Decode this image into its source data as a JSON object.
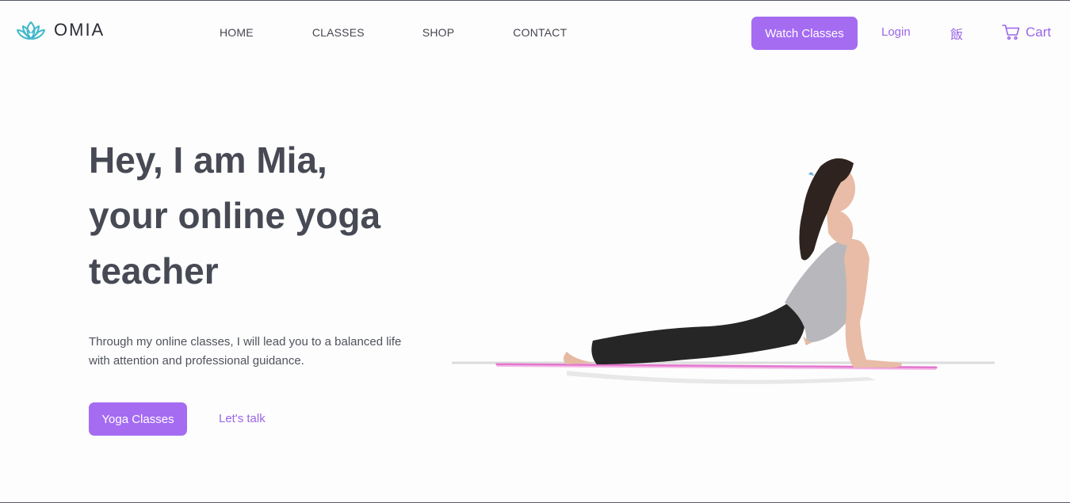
{
  "brand": {
    "name": "OMIA",
    "icon": "lotus-icon",
    "icon_color": "#3fb7c9"
  },
  "nav": {
    "items": [
      {
        "label": "HOME"
      },
      {
        "label": "CLASSES"
      },
      {
        "label": "SHOP"
      },
      {
        "label": "CONTACT"
      }
    ]
  },
  "header_actions": {
    "watch_classes_label": "Watch Classes",
    "login_label": "Login",
    "language_glyph": "飯",
    "cart_label": "Cart",
    "cart_icon": "cart-icon"
  },
  "hero": {
    "title_lines": [
      "Hey, I am Mia,",
      "your online yoga",
      "teacher"
    ],
    "description": "Through my online classes, I will lead you to a balanced life with attention and professional guidance.",
    "primary_cta": "Yoga Classes",
    "secondary_cta": "Let's talk",
    "image": "woman-in-cobra-pose-on-yoga-mat"
  },
  "colors": {
    "accent": "#a56cf2",
    "accent_text": "#9b66e8",
    "heading": "#474a54",
    "body_text": "#4f535c",
    "background": "#fdfdfd"
  }
}
